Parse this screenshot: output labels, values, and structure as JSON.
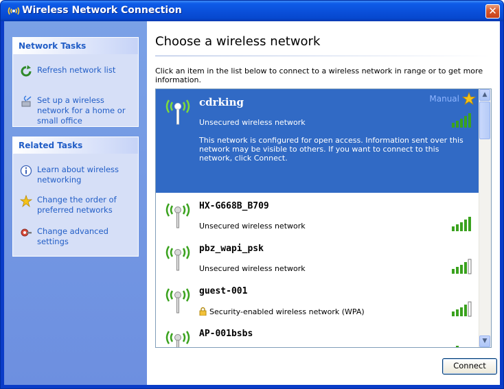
{
  "window": {
    "title": "Wireless Network Connection",
    "close_glyph": "✕"
  },
  "sidebar": {
    "network_tasks": {
      "header": "Network Tasks",
      "items": [
        {
          "label": "Refresh network list",
          "icon": "refresh-icon"
        },
        {
          "label": "Set up a wireless network for a home or small office",
          "icon": "setup-wireless-icon"
        }
      ]
    },
    "related_tasks": {
      "header": "Related Tasks",
      "items": [
        {
          "label": "Learn about wireless networking",
          "icon": "info-icon"
        },
        {
          "label": "Change the order of preferred networks",
          "icon": "star-icon"
        },
        {
          "label": "Change advanced settings",
          "icon": "settings-icon"
        }
      ]
    }
  },
  "main": {
    "heading": "Choose a wireless network",
    "instructions": "Click an item in the list below to connect to a wireless network in range or to get more information.",
    "networks": [
      {
        "name": "cdrking",
        "status": "Unsecured wireless network",
        "badge": "Manual",
        "description": "This network is configured for open access. Information sent over this network may be visible to others. If you want to connect to this network, click Connect.",
        "signal_bars": 5,
        "selected": true
      },
      {
        "name": "HX-G668B_B709",
        "status": "Unsecured wireless network",
        "signal_bars": 5
      },
      {
        "name": "pbz_wapi_psk",
        "status": "Unsecured wireless network",
        "signal_bars": 4
      },
      {
        "name": "guest-001",
        "status": "Security-enabled wireless network (WPA)",
        "signal_bars": 4,
        "secured": true
      },
      {
        "name": "AP-001bsbs",
        "status": "",
        "signal_bars": 2
      }
    ],
    "connect_label": "Connect"
  },
  "colors": {
    "title_bar": "#0a4fd9",
    "sidebar": "#7aa1e6",
    "task_link": "#215dc6",
    "selection": "#316ac5",
    "signal_on": "#3aa21e",
    "signal_off": "#ffffff",
    "close_button": "#d8582a"
  }
}
